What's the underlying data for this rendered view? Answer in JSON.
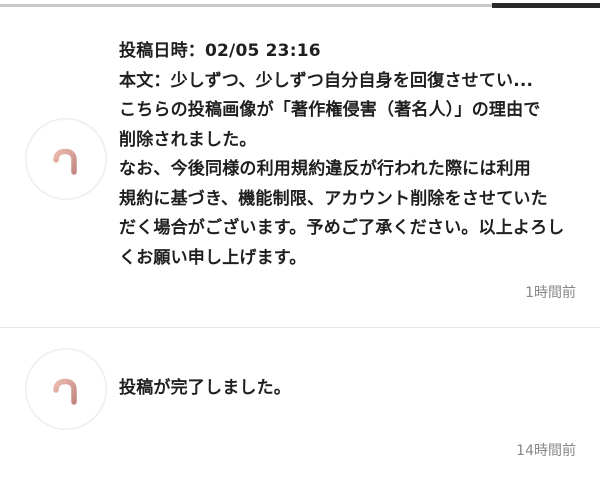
{
  "tabs": {
    "active_index": 1
  },
  "notifications": [
    {
      "icon": "h-logo-icon",
      "message": "投稿日時：02/05 23:16\n本文：少しずつ、少しずつ自分自身を回復させてい...\nこちらの投稿画像が「著作権侵害（著名人）」の理由で\n削除されました。\nなお、今後同様の利用規約違反が行われた際には利用\n規約に基づき、機能制限、アカウント削除をさせていた\nだく場合がございます。予めご了承ください。以上よろし\nくお願い申し上げます。",
      "time": "1時間前"
    },
    {
      "icon": "h-logo-icon",
      "message": "投稿が完了しました。",
      "time": "14時間前"
    }
  ],
  "colors": {
    "logo_gradient_start": "#e9b7ad",
    "logo_gradient_end": "#c98f8a",
    "time_text": "#888888",
    "active_tab": "#2a2a2a",
    "inactive_tab": "#c9c9c9"
  }
}
